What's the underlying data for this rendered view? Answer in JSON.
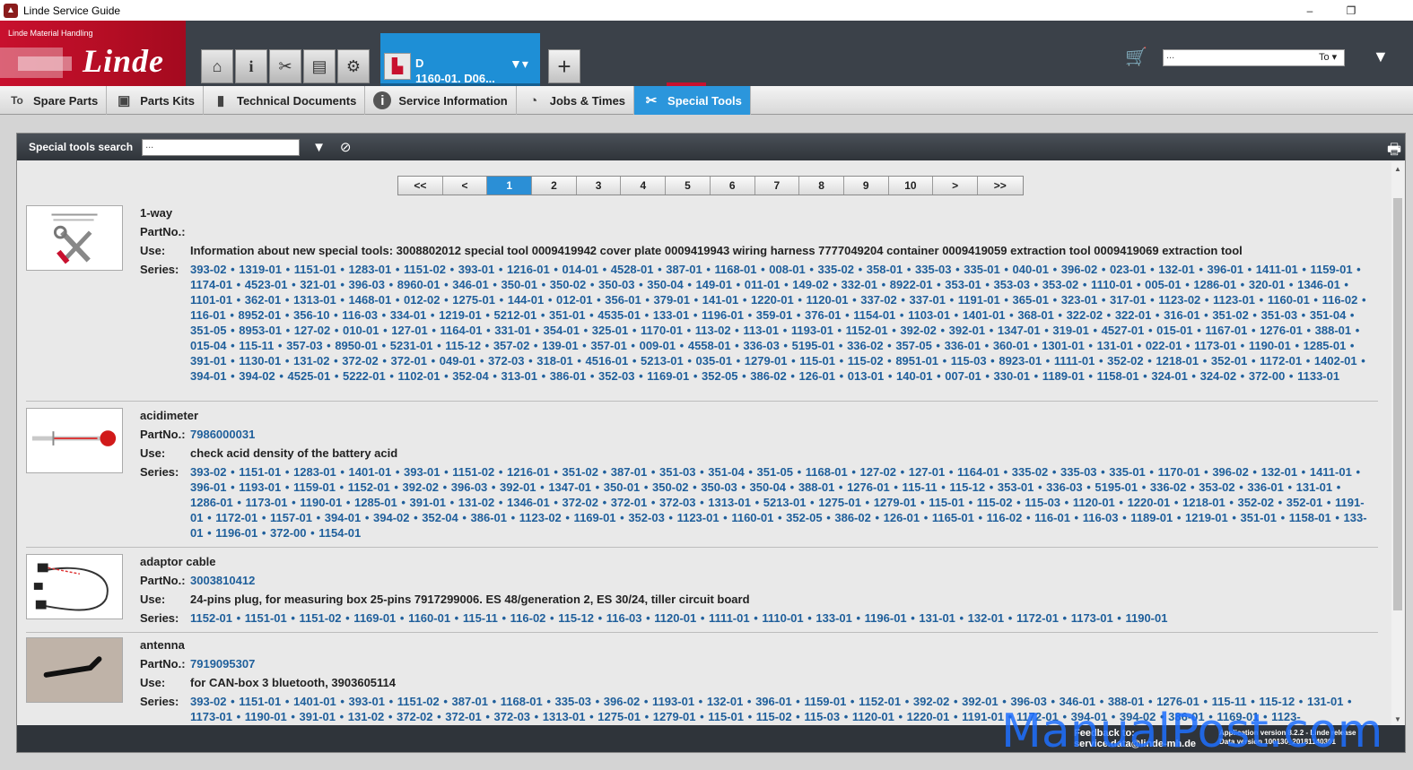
{
  "window": {
    "title": "Linde Service Guide",
    "minimize": "–",
    "restore": "❐"
  },
  "brand": {
    "tagline": "Linde Material Handling",
    "logo": "Linde"
  },
  "header": {
    "nav_icons": [
      "home-icon",
      "info-icon",
      "tools-icon",
      "truck-icon",
      "gear-icon"
    ],
    "doc_tab": {
      "line1": "D",
      "line2": "1160-01. D06..."
    },
    "add_label": "+",
    "search_placeholder": "...",
    "to_label": "To"
  },
  "subtabs": [
    {
      "label": "Spare Parts",
      "icon": "To"
    },
    {
      "label": "Parts Kits",
      "icon": "▣"
    },
    {
      "label": "Technical Documents",
      "icon": "▮"
    },
    {
      "label": "Service Information",
      "icon": "i"
    },
    {
      "label": "Jobs & Times",
      "icon": "◔"
    },
    {
      "label": "Special Tools",
      "icon": "✂"
    }
  ],
  "panel": {
    "search_label": "Special tools search",
    "search_placeholder": "...",
    "pager": [
      "<<",
      "<",
      "1",
      "2",
      "3",
      "4",
      "5",
      "6",
      "7",
      "8",
      "9",
      "10",
      ">",
      ">>"
    ],
    "current_page": "1"
  },
  "labels": {
    "partno": "PartNo.:",
    "use": "Use:",
    "series": "Series:"
  },
  "items": [
    {
      "name": "1-way",
      "partno": "",
      "use": "Information about new special tools: 3008802012 special tool 0009419942 cover plate 0009419943 wiring harness 7777049204 container 0009419059 extraction tool 0009419069 extraction tool",
      "series": "393-02 • 1319-01 • 1151-01 • 1283-01 • 1151-02 • 393-01 • 1216-01 • 014-01 • 4528-01 • 387-01 • 1168-01 • 008-01 • 335-02 • 358-01 • 335-03 • 335-01 • 040-01 • 396-02 • 023-01 • 132-01 • 396-01 • 1411-01 • 1159-01 • 1174-01 • 4523-01 • 321-01 • 396-03 • 8960-01 • 346-01 • 350-01 • 350-02 • 350-03 • 350-04 • 149-01 • 011-01 • 149-02 • 332-01 • 8922-01 • 353-01 • 353-03 • 353-02 • 1110-01 • 005-01 • 1286-01 • 320-01 • 1346-01 • 1101-01 • 362-01 • 1313-01 • 1468-01 • 012-02 • 1275-01 • 144-01 • 012-01 • 356-01 • 379-01 • 141-01 • 1220-01 • 1120-01 • 337-02 • 337-01 • 1191-01 • 365-01 • 323-01 • 317-01 • 1123-02 • 1123-01 • 1160-01 • 116-02 • 116-01 • 8952-01 • 356-10 • 116-03 • 334-01 • 1219-01 • 5212-01 • 351-01 • 4535-01 • 133-01 • 1196-01 • 359-01 • 376-01 • 1154-01 • 1103-01 • 1401-01 • 368-01 • 322-02 • 322-01 • 316-01 • 351-02 • 351-03 • 351-04 • 351-05 • 8953-01 • 127-02 • 010-01 • 127-01 • 1164-01 • 331-01 • 354-01 • 325-01 • 1170-01 • 113-02 • 113-01 • 1193-01 • 1152-01 • 392-02 • 392-01 • 1347-01 • 319-01 • 4527-01 • 015-01 • 1167-01 • 1276-01 • 388-01 • 015-04 • 115-11 • 357-03 • 8950-01 • 5231-01 • 115-12 • 357-02 • 139-01 • 357-01 • 009-01 • 4558-01 • 336-03 • 5195-01 • 336-02 • 357-05 • 336-01 • 360-01 • 1301-01 • 131-01 • 022-01 • 1173-01 • 1190-01 • 1285-01 • 391-01 • 1130-01 • 131-02 • 372-02 • 372-01 • 049-01 • 372-03 • 318-01 • 4516-01 • 5213-01 • 035-01 • 1279-01 • 115-01 • 115-02 • 8951-01 • 115-03 • 8923-01 • 1111-01 • 352-02 • 1218-01 • 352-01 • 1172-01 • 1402-01 • 394-01 • 394-02 • 4525-01 • 5222-01 • 1102-01 • 352-04 • 313-01 • 386-01 • 352-03 • 1169-01 • 352-05 • 386-02 • 126-01 • 013-01 • 140-01 • 007-01 • 330-01 • 1189-01 • 1158-01 • 324-01 • 324-02 • 372-00 • 1133-01"
    },
    {
      "name": "acidimeter",
      "partno": "7986000031",
      "use": "check acid density of the battery acid",
      "series": "393-02 • 1151-01 • 1283-01 • 1401-01 • 393-01 • 1151-02 • 1216-01 • 351-02 • 387-01 • 351-03 • 351-04 • 351-05 • 1168-01 • 127-02 • 127-01 • 1164-01 • 335-02 • 335-03 • 335-01 • 1170-01 • 396-02 • 132-01 • 1411-01 • 396-01 • 1193-01 • 1159-01 • 1152-01 • 392-02 • 396-03 • 392-01 • 1347-01 • 350-01 • 350-02 • 350-03 • 350-04 • 388-01 • 1276-01 • 115-11 • 115-12 • 353-01 • 336-03 • 5195-01 • 336-02 • 353-02 • 336-01 • 131-01 • 1286-01 • 1173-01 • 1190-01 • 1285-01 • 391-01 • 131-02 • 1346-01 • 372-02 • 372-01 • 372-03 • 1313-01 • 5213-01 • 1275-01 • 1279-01 • 115-01 • 115-02 • 115-03 • 1120-01 • 1220-01 • 1218-01 • 352-02 • 352-01 • 1191-01 • 1172-01 • 1157-01 • 394-01 • 394-02 • 352-04 • 386-01 • 1123-02 • 1169-01 • 352-03 • 1123-01 • 1160-01 • 352-05 • 386-02 • 126-01 • 1165-01 • 116-02 • 116-01 • 116-03 • 1189-01 • 1219-01 • 351-01 • 1158-01 • 133-01 • 1196-01 • 372-00 • 1154-01"
    },
    {
      "name": "adaptor cable",
      "partno": "3003810412",
      "use": "24-pins plug, for measuring box 25-pins 7917299006. ES 48/generation 2, ES 30/24, tiller circuit board",
      "series": "1152-01 • 1151-01 • 1151-02 • 1169-01 • 1160-01 • 115-11 • 116-02 • 115-12 • 116-03 • 1120-01 • 1111-01 • 1110-01 • 133-01 • 1196-01 • 131-01 • 132-01 • 1172-01 • 1173-01 • 1190-01"
    },
    {
      "name": "antenna",
      "partno": "7919095307",
      "use": "for CAN-box 3 bluetooth, 3903605114",
      "series": "393-02 • 1151-01 • 1401-01 • 393-01 • 1151-02 • 387-01 • 1168-01 • 335-03 • 396-02 • 1193-01 • 132-01 • 396-01 • 1159-01 • 1152-01 • 392-02 • 392-01 • 396-03 • 346-01 • 388-01 • 1276-01 • 115-11 • 115-12 • 131-01 • 1173-01 • 1190-01 • 391-01 • 131-02 • 372-02 • 372-01 • 372-03 • 1313-01 • 1275-01 • 1279-01 • 115-01 • 115-02 • 115-03 • 1120-01 • 1220-01 • 1191-01 • 1172-01 • 394-01 • 394-02 • 386-01 • 1169-01 • 1123-"
    }
  ],
  "footer": {
    "feedback": "Feedback to:",
    "feedback_email": "service.data@linde-mh.de",
    "version": "Application version 8.2.2 - Linde release",
    "version2": "Data version 100130_20181140301"
  },
  "watermark": "ManualPost.com"
}
